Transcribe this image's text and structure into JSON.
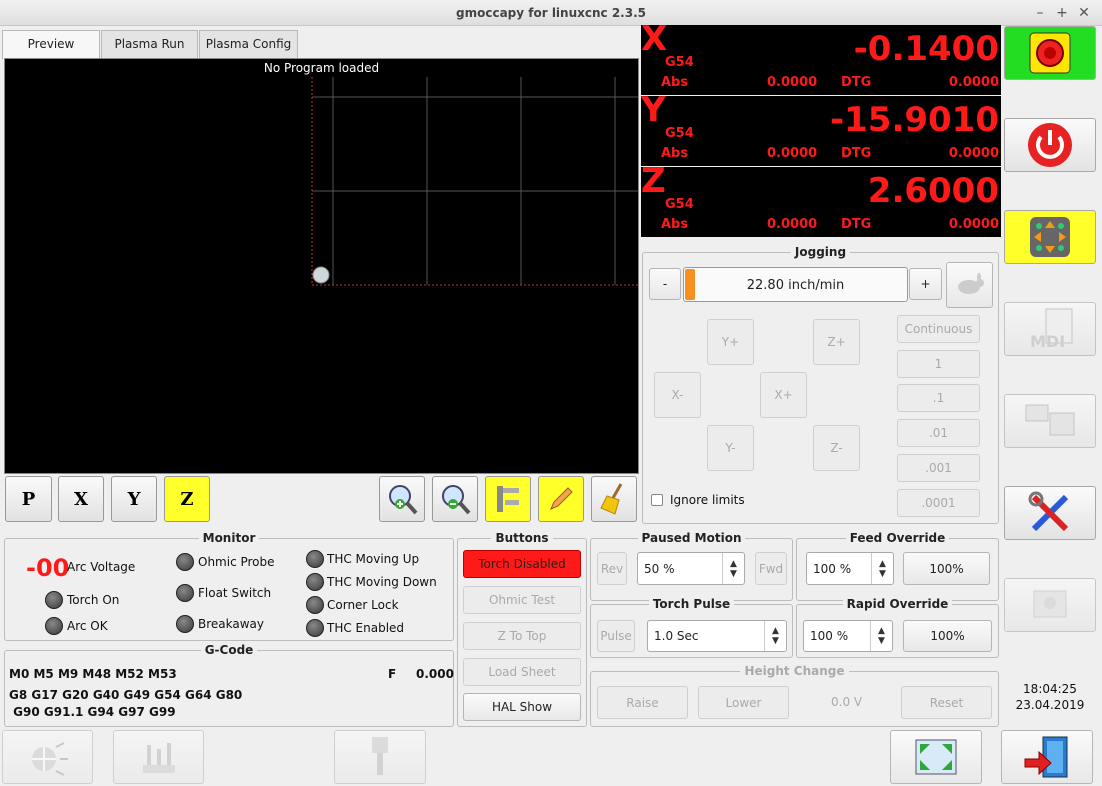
{
  "window": {
    "title": "gmoccapy for linuxcnc  2.3.5",
    "min": "–",
    "max": "+",
    "close": "✕"
  },
  "tabs": [
    {
      "label": "Preview"
    },
    {
      "label": "Plasma Run"
    },
    {
      "label": "Plasma Config"
    }
  ],
  "preview": {
    "message": "No Program loaded"
  },
  "view_buttons": {
    "p": "P",
    "x": "X",
    "y": "Y",
    "z": "Z"
  },
  "dro": [
    {
      "axis": "X",
      "system": "G54",
      "value": "-0.1400",
      "abs_label": "Abs",
      "abs": "0.0000",
      "dtg_label": "DTG",
      "dtg": "0.0000"
    },
    {
      "axis": "Y",
      "system": "G54",
      "value": "-15.9010",
      "abs_label": "Abs",
      "abs": "0.0000",
      "dtg_label": "DTG",
      "dtg": "0.0000"
    },
    {
      "axis": "Z",
      "system": "G54",
      "value": "2.6000",
      "abs_label": "Abs",
      "abs": "0.0000",
      "dtg_label": "DTG",
      "dtg": "0.0000"
    }
  ],
  "jogging": {
    "title": "Jogging",
    "minus": "-",
    "plus": "+",
    "speed": "22.80 inch/min",
    "speed_fraction": 0.0,
    "buttons": {
      "yplus": "Y+",
      "zplus": "Z+",
      "xminus": "X-",
      "xplus": "X+",
      "yminus": "Y-",
      "zminus": "Z-"
    },
    "increments": [
      "Continuous",
      "1",
      ".1",
      ".01",
      ".001",
      ".0001"
    ],
    "ignore_limits": "Ignore limits"
  },
  "monitor": {
    "title": "Monitor",
    "arc_voltage_value": "-00",
    "arc_voltage": "Arc Voltage",
    "torch_on": "Torch On",
    "arc_ok": "Arc OK",
    "ohmic_probe": "Ohmic Probe",
    "float_switch": "Float Switch",
    "breakaway": "Breakaway",
    "thc_moving_up": "THC Moving Up",
    "thc_moving_down": "THC Moving Down",
    "corner_lock": "Corner Lock",
    "thc_enabled": "THC Enabled"
  },
  "buttons_panel": {
    "title": "Buttons",
    "torch": "Torch Disabled",
    "ohmic": "Ohmic Test",
    "ztop": "Z To Top",
    "load": "Load Sheet",
    "hal": "HAL Show"
  },
  "gcode": {
    "title": "G-Code",
    "line1": "M0 M5 M9 M48 M52 M53",
    "f_label": "F",
    "f_value": "0.000",
    "line2": "G8 G17 G20 G40 G49 G54 G64 G80",
    "line3": " G90 G91.1 G94 G97 G99"
  },
  "paused_motion": {
    "title": "Paused Motion",
    "rev": "Rev",
    "speed": "50 %",
    "fwd": "Fwd"
  },
  "torch_pulse": {
    "title": "Torch Pulse",
    "pulse": "Pulse",
    "time": "1.0 Sec"
  },
  "feed_override": {
    "title": "Feed Override",
    "value": "100 %",
    "reset": "100%"
  },
  "rapid_override": {
    "title": "Rapid Override",
    "value": "100 %",
    "reset": "100%"
  },
  "height_change": {
    "title": "Height Change",
    "raise": "Raise",
    "lower": "Lower",
    "voltage": "0.0 V",
    "reset": "Reset"
  },
  "clock": {
    "time": "18:04:25",
    "date": "23.04.2019"
  },
  "colors": {
    "dro_red": "#ff1a1a",
    "estop_green": "#22dd22",
    "yellow": "#ffff2a",
    "torch_red": "#ff1a1a"
  },
  "icons": [
    "emergency-stop-icon",
    "power-icon",
    "jog-arrows-icon",
    "mdi-icon",
    "auto-icon",
    "settings-tools-icon",
    "user-tabs-icon",
    "zoom-in-icon",
    "zoom-out-icon",
    "measure-icon",
    "pencil-icon",
    "broom-icon",
    "touch-off-icon",
    "tool-table-icon",
    "spindle-icon",
    "fullscreen-icon",
    "exit-icon"
  ]
}
